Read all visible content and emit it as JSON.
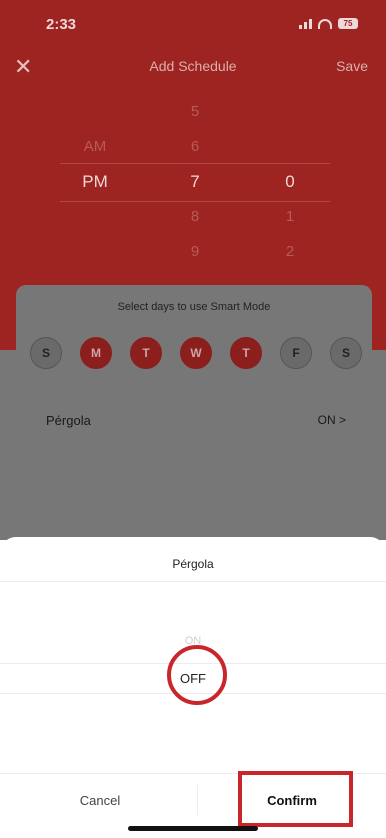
{
  "status_bar": {
    "time": "2:33",
    "battery": "75"
  },
  "nav": {
    "title": "Add Schedule",
    "save_label": "Save",
    "close_icon": "close-icon"
  },
  "time_picker": {
    "period": [
      "AM",
      "PM"
    ],
    "hours": [
      "5",
      "6",
      "7",
      "8",
      "9"
    ],
    "minutes": [
      "0",
      "1",
      "2"
    ],
    "selected": {
      "period": "PM",
      "hour": "7",
      "minute": "0"
    }
  },
  "days_card": {
    "caption": "Select days to use Smart Mode",
    "days": [
      {
        "label": "S",
        "selected": false
      },
      {
        "label": "M",
        "selected": true
      },
      {
        "label": "T",
        "selected": true
      },
      {
        "label": "W",
        "selected": true
      },
      {
        "label": "T",
        "selected": true
      },
      {
        "label": "F",
        "selected": false
      },
      {
        "label": "S",
        "selected": false
      }
    ],
    "row_label": "Pérgola",
    "row_value": "ON >"
  },
  "sheet": {
    "title": "Pérgola",
    "options": [
      "ON",
      "OFF"
    ],
    "selected_option": "OFF",
    "cancel_label": "Cancel",
    "confirm_label": "Confirm"
  },
  "colors": {
    "header_red": "#9e2421",
    "highlight_red": "#c9262b",
    "overlay_grey": "#777777"
  }
}
